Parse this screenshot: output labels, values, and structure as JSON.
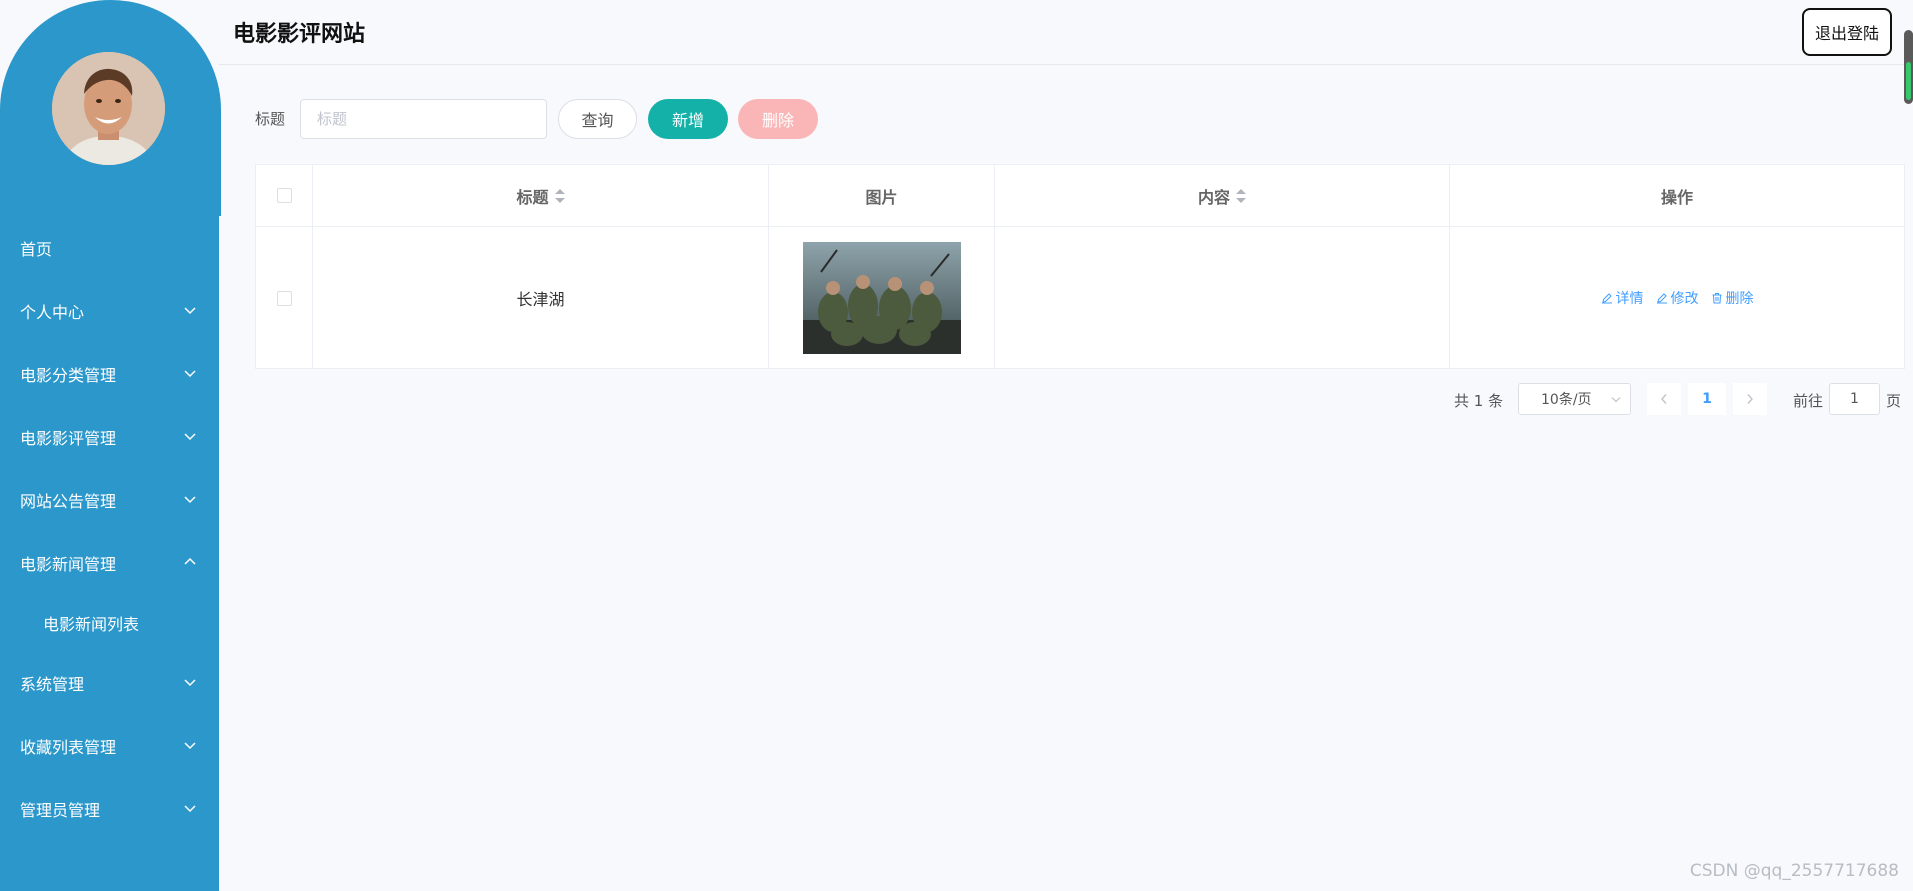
{
  "app": {
    "title": "电影影评网站",
    "logout_label": "退出登陆"
  },
  "sidebar": {
    "items": [
      {
        "label": "首页",
        "expandable": false
      },
      {
        "label": "个人中心",
        "expandable": true
      },
      {
        "label": "电影分类管理",
        "expandable": true
      },
      {
        "label": "电影影评管理",
        "expandable": true
      },
      {
        "label": "网站公告管理",
        "expandable": true
      },
      {
        "label": "电影新闻管理",
        "expandable": true,
        "expanded": true
      },
      {
        "label": "系统管理",
        "expandable": true
      },
      {
        "label": "收藏列表管理",
        "expandable": true
      },
      {
        "label": "管理员管理",
        "expandable": true
      }
    ],
    "submenu": {
      "label": "电影新闻列表"
    }
  },
  "search": {
    "label": "标题",
    "placeholder": "标题",
    "query_label": "查询",
    "add_label": "新增",
    "delete_label": "删除"
  },
  "table": {
    "headers": {
      "title": "标题",
      "image": "图片",
      "content": "内容",
      "actions": "操作"
    },
    "rows": [
      {
        "title": "长津湖",
        "content": ""
      }
    ],
    "actions": {
      "detail": "详情",
      "edit": "修改",
      "delete": "删除"
    }
  },
  "pagination": {
    "total": "共 1 条",
    "page_size": "10条/页",
    "current_page": "1",
    "goto_prefix": "前往",
    "goto_value": "1",
    "goto_suffix": "页"
  },
  "watermark": "CSDN @qq_2557717688",
  "colors": {
    "sidebar": "#2b97ca",
    "add": "#13b1a8",
    "delete": "#fab6b6",
    "link": "#409eff"
  }
}
